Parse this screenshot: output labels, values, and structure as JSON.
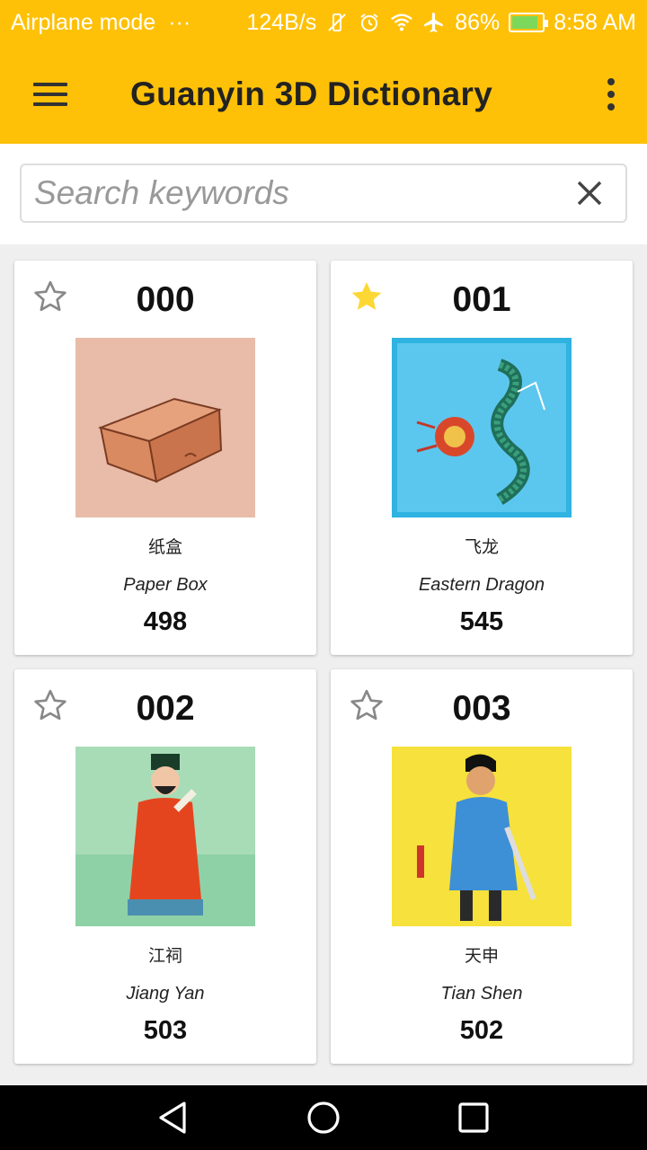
{
  "status_bar": {
    "mode": "Airplane mode",
    "more": "···",
    "net_speed": "124B/s",
    "battery_pct": "86%",
    "battery_level": 0.86,
    "time": "8:58 AM"
  },
  "app_bar": {
    "title": "Guanyin 3D Dictionary",
    "menu_icon": "hamburger-icon",
    "overflow_icon": "more-vert-icon"
  },
  "search": {
    "value": "",
    "placeholder": "Search keywords",
    "clear_icon": "close-icon"
  },
  "cards": [
    {
      "code": "000",
      "chinese": "纸盒",
      "english": "Paper Box",
      "number": "498",
      "favorite": false,
      "image": "paper-box-illustration"
    },
    {
      "code": "001",
      "chinese": "飞龙",
      "english": "Eastern Dragon",
      "number": "545",
      "favorite": true,
      "image": "eastern-dragon-illustration"
    },
    {
      "code": "002",
      "chinese": "江祠",
      "english": "Jiang Yan",
      "number": "503",
      "favorite": false,
      "image": "jiang-yan-illustration"
    },
    {
      "code": "003",
      "chinese": "天申",
      "english": "Tian Shen",
      "number": "502",
      "favorite": false,
      "image": "tian-shen-illustration"
    }
  ],
  "colors": {
    "primary": "#ffc107",
    "favorite_star": "#fdd835",
    "star_outline": "#888888",
    "caret": "#1e88e5"
  },
  "nav_bar": {
    "back_icon": "back-triangle-icon",
    "home_icon": "home-circle-icon",
    "recents_icon": "recents-square-icon"
  }
}
